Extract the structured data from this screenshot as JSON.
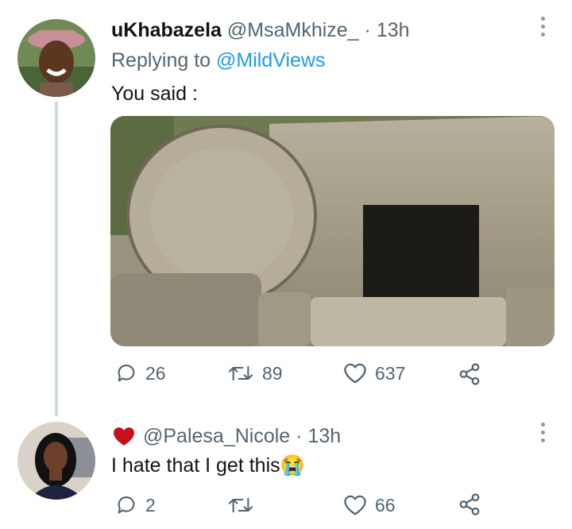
{
  "tweet": {
    "display_name": "uKhabazela",
    "handle": "@MsaMkhize_",
    "separator": "·",
    "time": "13h",
    "replying_prefix": "Replying to",
    "replying_to": "@MildViews",
    "text": "You said :",
    "image_alt": "stone tomb with rolled-away stone",
    "actions": {
      "replies": "26",
      "retweets": "89",
      "likes": "637"
    }
  },
  "reply": {
    "liked_icon": "heart-filled-icon",
    "handle": "@Palesa_Nicole",
    "separator": "·",
    "time": "13h",
    "text": "I hate that I get this",
    "emoji": "😭",
    "actions": {
      "replies": "2",
      "retweets": "",
      "likes": "66"
    }
  },
  "colors": {
    "accent": "#1d9bf0",
    "muted": "#536471",
    "heart": "#e0245e",
    "thread_line": "#cfd9de"
  }
}
